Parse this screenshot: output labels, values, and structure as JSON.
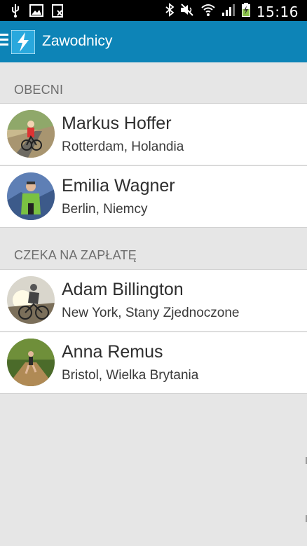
{
  "status_bar": {
    "time": "15:16",
    "icons": [
      "usb-icon",
      "image-icon",
      "clipboard-x-icon",
      "bluetooth-icon",
      "mute-icon",
      "wifi-icon",
      "signal-icon",
      "battery-charging-icon"
    ]
  },
  "action_bar": {
    "title": "Zawodnicy",
    "menu_icon": "menu-icon",
    "logo_icon": "app-logo-icon"
  },
  "sections": [
    {
      "label": "OBECNI",
      "athletes": [
        {
          "name": "Markus Hoffer",
          "location": "Rotterdam, Holandia"
        },
        {
          "name": "Emilia Wagner",
          "location": "Berlin, Niemcy"
        }
      ]
    },
    {
      "label": "CZEKA NA ZAPŁATĘ",
      "athletes": [
        {
          "name": "Adam Billington",
          "location": "New York, Stany Zjednoczone"
        },
        {
          "name": "Anna Remus",
          "location": "Bristol, Wielka Brytania"
        }
      ]
    }
  ],
  "colors": {
    "action_bar": "#0d84b7",
    "background": "#e6e6e6",
    "section_label": "#6e6e6e"
  }
}
